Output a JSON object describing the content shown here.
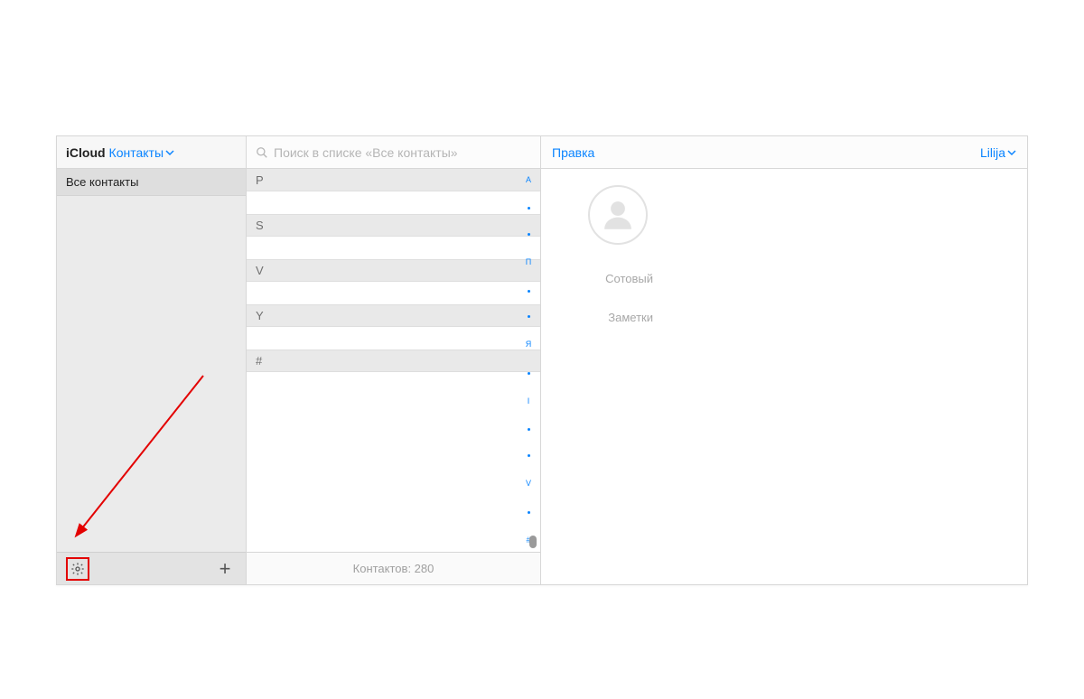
{
  "sidebar": {
    "brand": "iCloud",
    "section_label": "Контакты",
    "group_all": "Все контакты"
  },
  "search": {
    "placeholder": "Поиск в списке «Все контакты»"
  },
  "list": {
    "sections": [
      {
        "letter": "P",
        "rows": 1
      },
      {
        "letter": "S",
        "rows": 1
      },
      {
        "letter": "V",
        "rows": 1
      },
      {
        "letter": "Y",
        "rows": 1
      },
      {
        "letter": "#",
        "rows": 3
      }
    ],
    "footer": "Контактов: 280"
  },
  "index_strip": [
    "А",
    "",
    "",
    "П",
    "",
    "",
    "Я",
    "",
    "I",
    "",
    "",
    "V",
    "",
    "#"
  ],
  "detail": {
    "edit_label": "Правка",
    "user_name": "Lilija",
    "fields": {
      "phone_label": "Сотовый",
      "phone_value": "",
      "notes_label": "Заметки",
      "notes_value": ""
    }
  }
}
